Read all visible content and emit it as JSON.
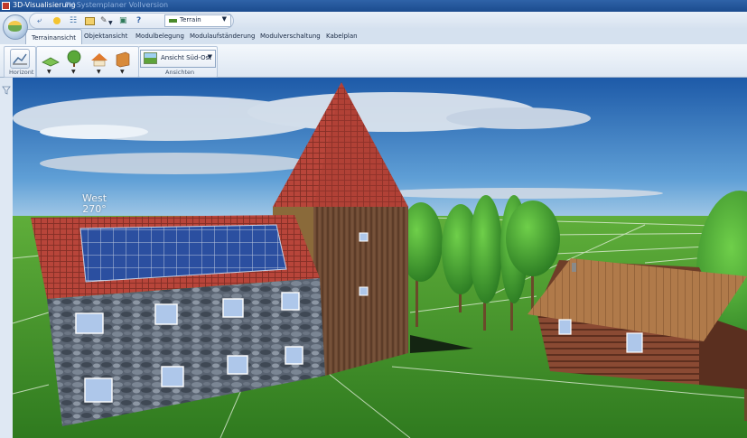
{
  "window": {
    "title": "3D-Visualisierung",
    "subtitle": "PV-Systemplaner Vollversion"
  },
  "quick_access": {
    "icons": [
      "back-arrow-icon",
      "bulb-icon",
      "hierarchy-icon",
      "window-icon",
      "brush-icon",
      "camera-icon",
      "help-icon"
    ],
    "help_label": "?",
    "terrain_combo": {
      "value": "Terrain"
    }
  },
  "tabs": [
    {
      "label": "Terrainansicht",
      "active": true
    },
    {
      "label": "Objektansicht",
      "active": false
    },
    {
      "label": "Modulbelegung",
      "active": false
    },
    {
      "label": "Modulaufständerung",
      "active": false
    },
    {
      "label": "Modulverschaltung",
      "active": false
    },
    {
      "label": "Kabelplan",
      "active": false
    }
  ],
  "ribbon": {
    "horizont_label": "Horizont",
    "ansichten_label": "Ansichten",
    "view_combo": {
      "value": "Ansicht Süd-Ost"
    },
    "tool_buttons": [
      "terrain-plane-icon",
      "tree-icon",
      "house-roof-icon",
      "wall-icon"
    ]
  },
  "scene": {
    "compass_direction": "West",
    "compass_angle": "270°",
    "colors": {
      "sky_top": "#1f5fb0",
      "sky_bottom": "#8fbde0",
      "grass": "#3f8f2a",
      "roof_tiles": "#b8453a",
      "stone": "#4d5866",
      "wood": "#8a5a3b"
    }
  }
}
